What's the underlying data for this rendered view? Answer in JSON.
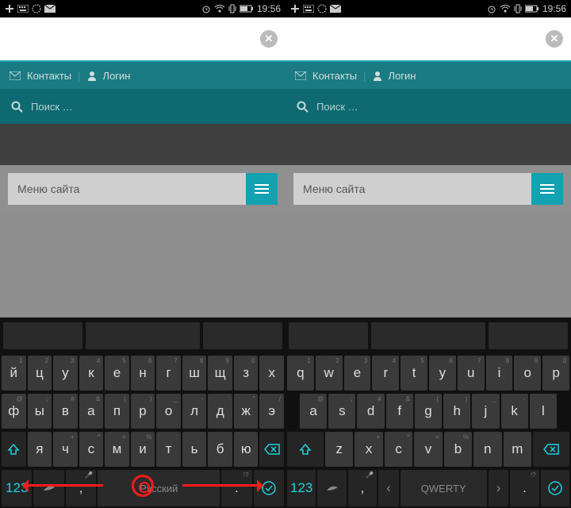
{
  "status": {
    "time": "19:56"
  },
  "nav": {
    "contacts": "Контакты",
    "login": "Логин",
    "separator": "|"
  },
  "search": {
    "placeholder": "Поиск …"
  },
  "menu": {
    "label": "Меню сайта"
  },
  "keyboards": {
    "ru": {
      "row1": [
        {
          "m": "й",
          "h": "1"
        },
        {
          "m": "ц",
          "h": "2"
        },
        {
          "m": "у",
          "h": "3"
        },
        {
          "m": "к",
          "h": "4"
        },
        {
          "m": "е",
          "h": "5"
        },
        {
          "m": "н",
          "h": "6"
        },
        {
          "m": "г",
          "h": "7"
        },
        {
          "m": "ш",
          "h": "8"
        },
        {
          "m": "щ",
          "h": "9"
        },
        {
          "m": "з",
          "h": "0"
        },
        {
          "m": "х",
          "h": ""
        }
      ],
      "row2": [
        {
          "m": "ф",
          "h": "@"
        },
        {
          "m": "ы",
          "h": ";"
        },
        {
          "m": "в",
          "h": "#"
        },
        {
          "m": "а",
          "h": "&"
        },
        {
          "m": "п",
          "h": "("
        },
        {
          "m": "р",
          "h": ")"
        },
        {
          "m": "о",
          "h": "_"
        },
        {
          "m": "л",
          "h": "-"
        },
        {
          "m": "д",
          "h": "'"
        },
        {
          "m": "ж",
          "h": "\""
        },
        {
          "m": "э",
          "h": "/"
        }
      ],
      "row3": [
        {
          "m": "я",
          "h": ""
        },
        {
          "m": "ч",
          "h": "+"
        },
        {
          "m": "с",
          "h": "*"
        },
        {
          "m": "м",
          "h": "="
        },
        {
          "m": "и",
          "h": "%"
        },
        {
          "m": "т",
          "h": ":"
        },
        {
          "m": "ь",
          "h": ""
        },
        {
          "m": "б",
          "h": ""
        },
        {
          "m": "ю",
          "h": ""
        }
      ],
      "space": "Русский",
      "numkey": "123"
    },
    "en": {
      "row1": [
        {
          "m": "q",
          "h": "1"
        },
        {
          "m": "w",
          "h": "2"
        },
        {
          "m": "e",
          "h": "3"
        },
        {
          "m": "r",
          "h": "4"
        },
        {
          "m": "t",
          "h": "5"
        },
        {
          "m": "y",
          "h": "6"
        },
        {
          "m": "u",
          "h": "7"
        },
        {
          "m": "i",
          "h": "8"
        },
        {
          "m": "o",
          "h": "9"
        },
        {
          "m": "p",
          "h": "0"
        }
      ],
      "row2": [
        {
          "m": "a",
          "h": "@"
        },
        {
          "m": "s",
          "h": ";"
        },
        {
          "m": "d",
          "h": "#"
        },
        {
          "m": "f",
          "h": "&"
        },
        {
          "m": "g",
          "h": "("
        },
        {
          "m": "h",
          "h": ")"
        },
        {
          "m": "j",
          "h": "_"
        },
        {
          "m": "k",
          "h": "-"
        },
        {
          "m": "l",
          "h": "'"
        }
      ],
      "row3": [
        {
          "m": "z",
          "h": ""
        },
        {
          "m": "x",
          "h": "+"
        },
        {
          "m": "c",
          "h": "*"
        },
        {
          "m": "v",
          "h": "="
        },
        {
          "m": "b",
          "h": "%"
        },
        {
          "m": "n",
          "h": ":"
        },
        {
          "m": "m",
          "h": ""
        }
      ],
      "space": "QWERTY",
      "numkey": "123"
    },
    "punct": {
      "comma": ",",
      "period": ".",
      "excl": "!",
      "ques": "?"
    }
  }
}
